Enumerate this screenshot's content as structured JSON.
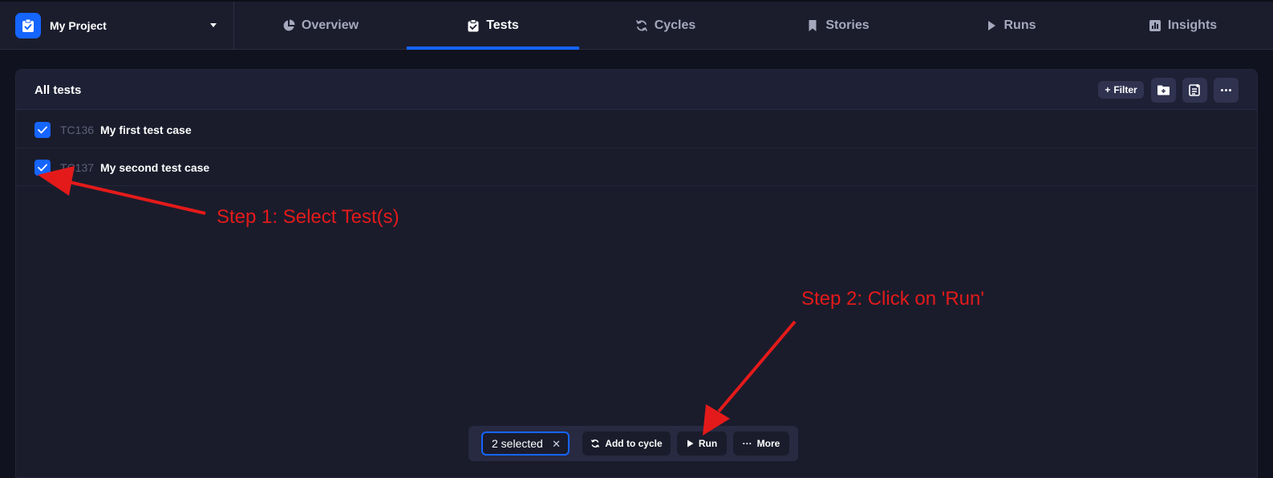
{
  "project": {
    "name": "My Project",
    "logo_icon": "clipboard-check-icon",
    "dropdown_icon": "caret-down-icon"
  },
  "nav": {
    "tabs": [
      {
        "label": "Overview",
        "icon": "pie-chart-icon"
      },
      {
        "label": "Tests",
        "icon": "clipboard-check-icon",
        "active": true
      },
      {
        "label": "Cycles",
        "icon": "refresh-icon"
      },
      {
        "label": "Stories",
        "icon": "bookmark-icon"
      },
      {
        "label": "Runs",
        "icon": "play-icon"
      },
      {
        "label": "Insights",
        "icon": "bar-chart-icon"
      }
    ]
  },
  "panel": {
    "title": "All tests",
    "filter_label": "Filter",
    "actions": [
      "new-folder-icon",
      "new-test-icon",
      "more-icon"
    ]
  },
  "tests": [
    {
      "id": "TC136",
      "name": "My first test case",
      "checked": true
    },
    {
      "id": "TC137",
      "name": "My second test case",
      "checked": true
    }
  ],
  "annotations": {
    "step1": "Step 1: Select Test(s)",
    "step2": "Step 2: Click on 'Run'"
  },
  "bulk_bar": {
    "selected_label": "2 selected",
    "add_to_cycle_label": "Add to cycle",
    "run_label": "Run",
    "more_label": "More"
  },
  "colors": {
    "accent": "#1565ff",
    "annotation": "#e41a1a",
    "background": "#11121f"
  }
}
